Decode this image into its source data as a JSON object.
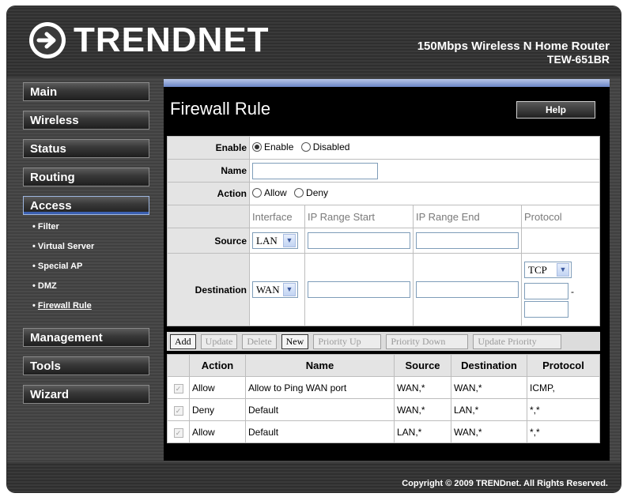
{
  "header": {
    "brand": "TRENDNET",
    "product_name": "150Mbps Wireless N Home Router",
    "product_model": "TEW-651BR"
  },
  "nav": {
    "main": "Main",
    "wireless": "Wireless",
    "status": "Status",
    "routing": "Routing",
    "access": "Access",
    "access_items": [
      "Filter",
      "Virtual Server",
      "Special AP",
      "DMZ",
      "Firewall Rule"
    ],
    "management": "Management",
    "tools": "Tools",
    "wizard": "Wizard"
  },
  "page": {
    "title": "Firewall Rule",
    "help": "Help"
  },
  "form": {
    "enable_label": "Enable",
    "enable_opt": "Enable",
    "disabled_opt": "Disabled",
    "name_label": "Name",
    "name_value": "",
    "action_label": "Action",
    "allow_opt": "Allow",
    "deny_opt": "Deny",
    "col_interface": "Interface",
    "col_ip_start": "IP Range Start",
    "col_ip_end": "IP Range End",
    "col_protocol": "Protocol",
    "source_label": "Source",
    "source_interface": "LAN",
    "dest_label": "Destination",
    "dest_interface": "WAN",
    "dest_protocol": "TCP",
    "port_dash": "-"
  },
  "buttons": {
    "add": "Add",
    "update": "Update",
    "delete": "Delete",
    "new": "New",
    "priority_up": "Priority Up",
    "priority_down": "Priority Down",
    "update_priority": "Update Priority"
  },
  "rules": {
    "headers": [
      "Action",
      "Name",
      "Source",
      "Destination",
      "Protocol"
    ],
    "rows": [
      {
        "action": "Allow",
        "name": "Allow to Ping WAN port",
        "source": "WAN,*",
        "destination": "WAN,*",
        "protocol": "ICMP,"
      },
      {
        "action": "Deny",
        "name": "Default",
        "source": "WAN,*",
        "destination": "LAN,*",
        "protocol": "*,*"
      },
      {
        "action": "Allow",
        "name": "Default",
        "source": "LAN,*",
        "destination": "WAN,*",
        "protocol": "*,*"
      }
    ]
  },
  "footer": {
    "copyright": "Copyright © 2009 TRENDnet. All Rights Reserved."
  },
  "colors": {
    "accent_blue": "#3a5fb0",
    "background_dark": "#404040"
  }
}
